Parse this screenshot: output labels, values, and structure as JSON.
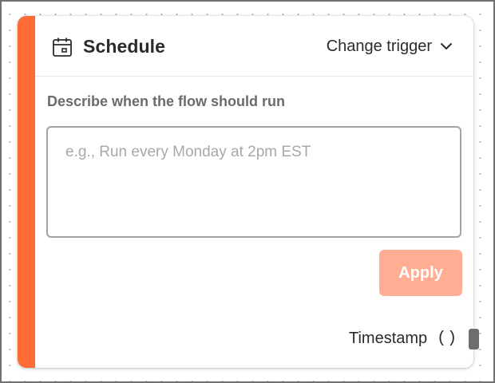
{
  "node": {
    "title": "Schedule",
    "icon": "calendar-icon",
    "accent_color": "#ff6b35",
    "change_trigger": {
      "label": "Change trigger",
      "icon": "chevron-down-icon"
    },
    "describe_label": "Describe when the flow should run",
    "input": {
      "value": "",
      "placeholder": "e.g., Run every Monday at 2pm EST"
    },
    "apply_button": {
      "label": "Apply",
      "color": "#ffae94",
      "disabled_look": true
    },
    "output": {
      "label": "Timestamp",
      "type_symbol": "()"
    }
  }
}
